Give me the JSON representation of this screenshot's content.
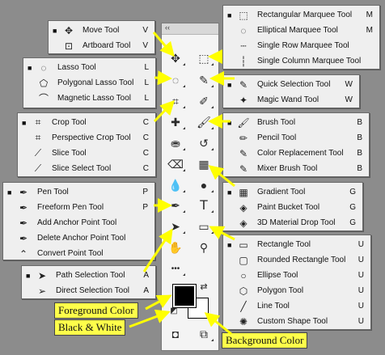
{
  "toolbar": {
    "collapse_label": "‹‹"
  },
  "flyouts": {
    "move": [
      {
        "icon": "move-icon",
        "glyph": "✥",
        "label": "Move Tool",
        "key": "V",
        "active": true
      },
      {
        "icon": "artboard-icon",
        "glyph": "⊡",
        "label": "Artboard Tool",
        "key": "V",
        "active": false
      }
    ],
    "lasso": [
      {
        "icon": "lasso-icon",
        "glyph": "◌",
        "label": "Lasso Tool",
        "key": "L",
        "active": true
      },
      {
        "icon": "polygonal-lasso-icon",
        "glyph": "⬠",
        "label": "Polygonal Lasso Tool",
        "key": "L",
        "active": false
      },
      {
        "icon": "magnetic-lasso-icon",
        "glyph": "⌒",
        "label": "Magnetic Lasso Tool",
        "key": "L",
        "active": false
      }
    ],
    "crop": [
      {
        "icon": "crop-icon",
        "glyph": "⌗",
        "label": "Crop Tool",
        "key": "C",
        "active": true
      },
      {
        "icon": "perspective-crop-icon",
        "glyph": "⌗",
        "label": "Perspective Crop Tool",
        "key": "C",
        "active": false
      },
      {
        "icon": "slice-icon",
        "glyph": "⟋",
        "label": "Slice Tool",
        "key": "C",
        "active": false
      },
      {
        "icon": "slice-select-icon",
        "glyph": "⟋",
        "label": "Slice Select Tool",
        "key": "C",
        "active": false
      }
    ],
    "pen": [
      {
        "icon": "pen-icon",
        "glyph": "✒",
        "label": "Pen Tool",
        "key": "P",
        "active": true
      },
      {
        "icon": "freeform-pen-icon",
        "glyph": "✒",
        "label": "Freeform Pen Tool",
        "key": "P",
        "active": false
      },
      {
        "icon": "add-anchor-icon",
        "glyph": "✒",
        "label": "Add Anchor Point Tool",
        "key": "",
        "active": false
      },
      {
        "icon": "delete-anchor-icon",
        "glyph": "✒",
        "label": "Delete Anchor Point Tool",
        "key": "",
        "active": false
      },
      {
        "icon": "convert-point-icon",
        "glyph": "⌃",
        "label": "Convert Point Tool",
        "key": "",
        "active": false
      }
    ],
    "path_selection": [
      {
        "icon": "path-selection-icon",
        "glyph": "➤",
        "label": "Path Selection Tool",
        "key": "A",
        "active": true
      },
      {
        "icon": "direct-selection-icon",
        "glyph": "➢",
        "label": "Direct Selection Tool",
        "key": "A",
        "active": false
      }
    ],
    "marquee": [
      {
        "icon": "rect-marquee-icon",
        "glyph": "⬚",
        "label": "Rectangular Marquee Tool",
        "key": "M",
        "active": true
      },
      {
        "icon": "ellipse-marquee-icon",
        "glyph": "◌",
        "label": "Elliptical Marquee Tool",
        "key": "M",
        "active": false
      },
      {
        "icon": "single-row-icon",
        "glyph": "┄",
        "label": "Single Row Marquee Tool",
        "key": "",
        "active": false
      },
      {
        "icon": "single-column-icon",
        "glyph": "┆",
        "label": "Single Column Marquee Tool",
        "key": "",
        "active": false
      }
    ],
    "quick_selection": [
      {
        "icon": "quick-selection-icon",
        "glyph": "✎",
        "label": "Quick Selection Tool",
        "key": "W",
        "active": true
      },
      {
        "icon": "magic-wand-icon",
        "glyph": "✦",
        "label": "Magic Wand Tool",
        "key": "W",
        "active": false
      }
    ],
    "brush": [
      {
        "icon": "brush-icon",
        "glyph": "🖌",
        "label": "Brush Tool",
        "key": "B",
        "active": true
      },
      {
        "icon": "pencil-icon",
        "glyph": "✏",
        "label": "Pencil Tool",
        "key": "B",
        "active": false
      },
      {
        "icon": "color-replacement-icon",
        "glyph": "✎",
        "label": "Color Replacement Tool",
        "key": "B",
        "active": false
      },
      {
        "icon": "mixer-brush-icon",
        "glyph": "✎",
        "label": "Mixer Brush Tool",
        "key": "B",
        "active": false
      }
    ],
    "gradient": [
      {
        "icon": "gradient-icon",
        "glyph": "▦",
        "label": "Gradient Tool",
        "key": "G",
        "active": true
      },
      {
        "icon": "paint-bucket-icon",
        "glyph": "◈",
        "label": "Paint Bucket Tool",
        "key": "G",
        "active": false
      },
      {
        "icon": "material-drop-icon",
        "glyph": "◈",
        "label": "3D Material Drop Tool",
        "key": "G",
        "active": false
      }
    ],
    "shape": [
      {
        "icon": "rectangle-icon",
        "glyph": "▭",
        "label": "Rectangle Tool",
        "key": "U",
        "active": true
      },
      {
        "icon": "rounded-rectangle-icon",
        "glyph": "▢",
        "label": "Rounded Rectangle Tool",
        "key": "U",
        "active": false
      },
      {
        "icon": "ellipse-icon",
        "glyph": "○",
        "label": "Ellipse Tool",
        "key": "U",
        "active": false
      },
      {
        "icon": "polygon-icon",
        "glyph": "⬡",
        "label": "Polygon Tool",
        "key": "U",
        "active": false
      },
      {
        "icon": "line-icon",
        "glyph": "╱",
        "label": "Line Tool",
        "key": "U",
        "active": false
      },
      {
        "icon": "custom-shape-icon",
        "glyph": "✺",
        "label": "Custom Shape Tool",
        "key": "U",
        "active": false
      }
    ]
  },
  "callouts": {
    "foreground": "Foreground Color",
    "black_white": "Black & White",
    "background": "Background Color"
  },
  "tool_glyphs": {
    "move": "✥",
    "marquee": "⬚",
    "lasso": "◌",
    "quick": "✎",
    "crop": "⌗",
    "eyedropper": "✐",
    "healing": "✚",
    "brush": "🖌",
    "stamp": "⛂",
    "history": "↺",
    "eraser": "⌫",
    "gradient": "▦",
    "blur": "💧",
    "dodge": "●",
    "pen": "✒",
    "type": "T",
    "path": "➤",
    "shape": "▭",
    "hand": "✋",
    "zoom": "⚲",
    "more": "•••",
    "swap": "⇄",
    "reset": "◩",
    "quickmask": "◘",
    "screen": "⧉"
  },
  "colors": {
    "foreground": "#000000",
    "background": "#ffffff",
    "callout": "#ffff4a",
    "arrow": "#ffff00"
  }
}
